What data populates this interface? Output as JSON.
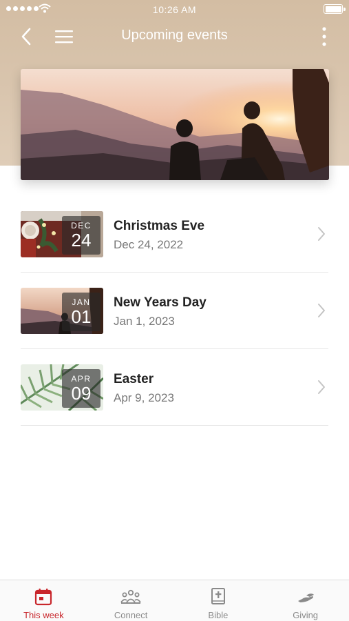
{
  "status_bar": {
    "time": "10:26 AM"
  },
  "nav": {
    "title": "Upcoming events"
  },
  "events": [
    {
      "month": "DEC",
      "day": "24",
      "title": "Christmas Eve",
      "date": "Dec 24, 2022",
      "thumb": "dinner-table"
    },
    {
      "month": "JAN",
      "day": "01",
      "title": "New Years Day",
      "date": "Jan 1, 2023",
      "thumb": "sunset-hikers"
    },
    {
      "month": "APR",
      "day": "09",
      "title": "Easter",
      "date": "Apr 9, 2023",
      "thumb": "palm-leaves"
    }
  ],
  "tabs": [
    {
      "label": "This week",
      "icon": "calendar-icon",
      "active": true
    },
    {
      "label": "Connect",
      "icon": "people-icon",
      "active": false
    },
    {
      "label": "Bible",
      "icon": "bible-icon",
      "active": false
    },
    {
      "label": "Giving",
      "icon": "giving-hand-icon",
      "active": false
    }
  ],
  "colors": {
    "accent": "#c8262b",
    "header": "#d3bda3",
    "inactive": "#8a8a8a"
  }
}
